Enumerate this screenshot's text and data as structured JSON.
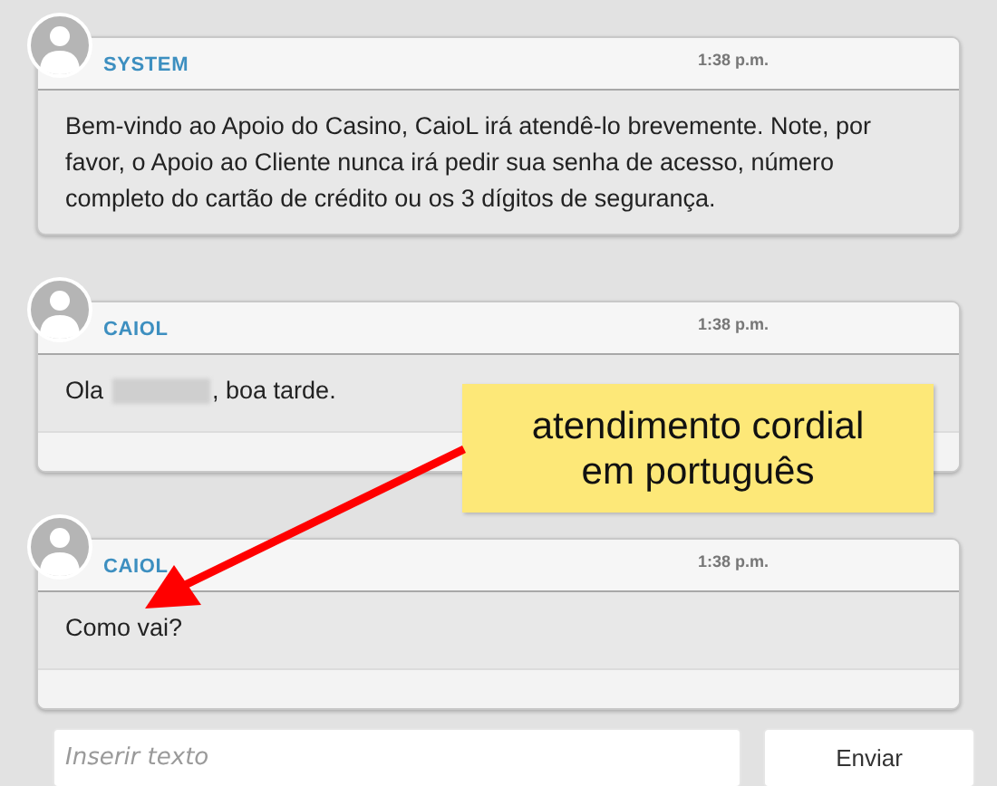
{
  "messages": [
    {
      "sender": "SYSTEM",
      "time": "1:38 p.m.",
      "segments": [
        {
          "kind": "text",
          "text": "Bem-vindo ao Apoio do Casino, CaioL irá atendê-lo brevemente. Note, por favor, o Apoio ao Cliente nunca irá pedir sua senha de acesso, número completo do cartão de crédito ou os 3 dígitos de segurança."
        }
      ],
      "footer": false
    },
    {
      "sender": "CAIOL",
      "time": "1:38 p.m.",
      "segments": [
        {
          "kind": "text",
          "text": "Ola"
        },
        {
          "kind": "redacted"
        },
        {
          "kind": "text",
          "text": ", boa tarde."
        }
      ],
      "footer": true
    },
    {
      "sender": "CAIOL",
      "time": "1:38 p.m.",
      "segments": [
        {
          "kind": "text",
          "text": "Como vai?"
        }
      ],
      "footer": true
    }
  ],
  "composer": {
    "placeholder": "Inserir texto",
    "button": "Enviar"
  },
  "callout": {
    "text": "atendimento cordial em português"
  }
}
